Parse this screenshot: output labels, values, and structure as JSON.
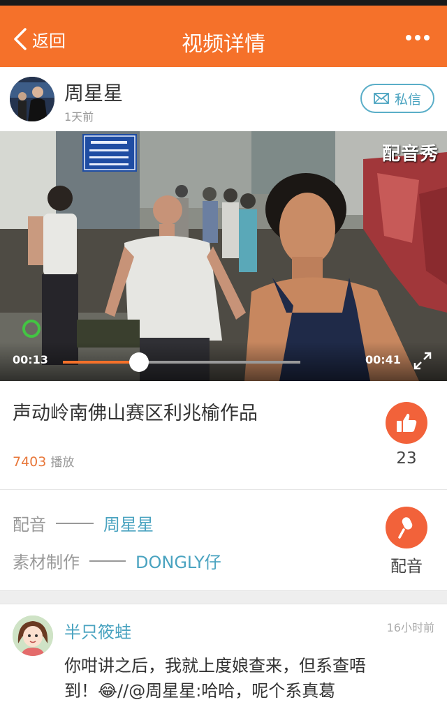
{
  "navbar": {
    "back_label": "返回",
    "title": "视频详情",
    "back_icon": "chevron-left-icon",
    "more_icon": "more-dots-icon",
    "color": "#f5712a"
  },
  "author": {
    "name": "周星星",
    "time": "1天前",
    "message_label": "私信",
    "message_icon": "envelope-icon"
  },
  "video": {
    "watermark": "配音秀",
    "current_time": "00:13",
    "total_time": "00:41",
    "progress": 0.32,
    "fullscreen_icon": "expand-icon"
  },
  "info": {
    "title": "声动岭南佛山赛区利兆榆作品",
    "play_count": "7403",
    "play_label": "播放",
    "like_count": "23",
    "like_icon": "thumbs-up-icon"
  },
  "credits": {
    "dub_role": "配音",
    "dub_person": "周星星",
    "material_role": "素材制作",
    "material_person": "DONGLY仔",
    "dub_button_label": "配音",
    "dub_icon": "microphone-icon"
  },
  "comment": {
    "user": "半只筱蛙",
    "time": "16小时前",
    "text_line1": "你咁讲之后，我就上度娘查来，但系查唔",
    "text_line2_a": "到！",
    "text_line2_b": "//@周星星:哈哈，呢个系真葛",
    "emoji": "😂"
  },
  "colors": {
    "accent": "#f5712a",
    "link": "#4aa3c0",
    "like": "#f2623a"
  }
}
